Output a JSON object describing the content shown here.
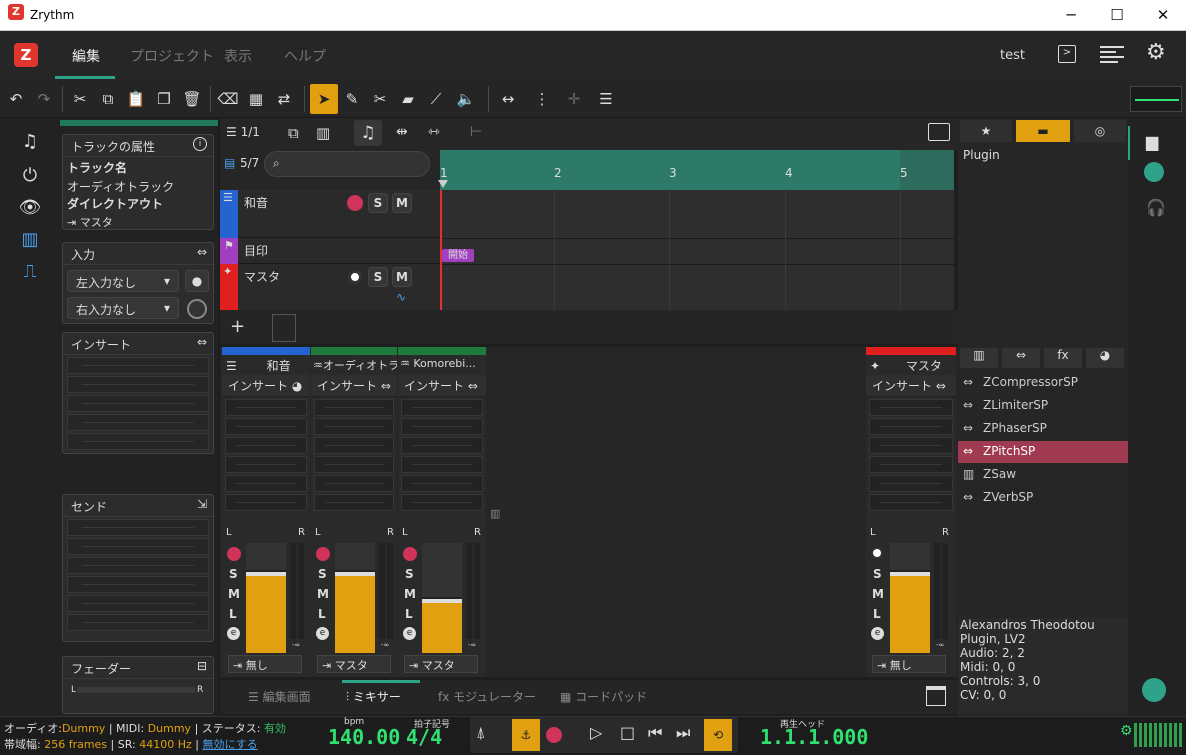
{
  "window": {
    "title": "Zrythm",
    "min": "─",
    "max": "☐",
    "close": "✕"
  },
  "menu": {
    "items": [
      "編集",
      "プロジェクト",
      "表示",
      "ヘルプ"
    ],
    "active": "編集",
    "user": "test"
  },
  "toolbar": {
    "icons": [
      "undo-icon",
      "redo-icon",
      "cut-icon",
      "copy-icon",
      "paste-icon",
      "duplicate-icon",
      "delete-icon",
      "clear-icon",
      "select-all-icon",
      "loop-icon",
      "select-tool-icon",
      "pencil-tool-icon",
      "cut-tool-icon",
      "eraser-tool-icon",
      "ramp-tool-icon",
      "audition-tool-icon"
    ]
  },
  "inspector": {
    "track_props": "トラックの属性",
    "track_name_label": "トラック名",
    "track_name_value": "オーディオトラック",
    "direct_out_label": "ダイレクトアウト",
    "direct_out_value": "マスタ",
    "input_title": "入力",
    "left_input": "左入力なし",
    "right_input": "右入力なし",
    "inserts_title": "インサート",
    "sends_title": "センド",
    "fader_title": "フェーダー",
    "fader_l": "L",
    "fader_r": "R"
  },
  "arranger": {
    "tracks_count": "1/1",
    "visible_tracks": "5/7",
    "ruler": [
      "1",
      "2",
      "3",
      "4",
      "5"
    ],
    "tracks": [
      {
        "name": "和音",
        "color": "#2563d0"
      },
      {
        "name": "目印",
        "color": "#a040c0"
      },
      {
        "name": "マスタ",
        "color": "#e02020"
      }
    ],
    "marker": "開始",
    "s_label": "S",
    "m_label": "M"
  },
  "mixer": {
    "channels": [
      {
        "name": "和音",
        "color": "#2563d0",
        "insert": "インサート",
        "out": "無し",
        "fader": 0.7
      },
      {
        "name": "オーディオトラ...",
        "color": "#1f7a3e",
        "insert": "インサート",
        "out": "マスタ",
        "fader": 0.7
      },
      {
        "name": "Komorebi...",
        "color": "#1f7a3e",
        "insert": "インサート",
        "out": "マスタ",
        "fader": 0.45
      }
    ],
    "master": {
      "name": "マスタ",
      "color": "#e02020",
      "insert": "インサート",
      "out": "無し",
      "fader": 0.7
    },
    "l": "L",
    "r": "R",
    "s": "S",
    "m": "M",
    "lbl": "L",
    "e": "e",
    "db": "-∞"
  },
  "bottom_tabs": [
    "編集画面",
    "ミキサー",
    "モジュレーター",
    "コードパッド"
  ],
  "bottom_active": "ミキサー",
  "browser": {
    "plugin_label": "Plugin",
    "plugins": [
      "ZCompressorSP",
      "ZLimiterSP",
      "ZPhaserSP",
      "ZPitchSP",
      "ZSaw",
      "ZVerbSP"
    ],
    "selected": "ZPitchSP",
    "info": [
      "Alexandros Theodotou",
      "Plugin, LV2",
      "Audio: 2, 2",
      "Midi: 0, 0",
      "Controls: 3, 0",
      "CV: 0, 0"
    ]
  },
  "status": {
    "audio_label": "オーディオ:",
    "audio_value": "Dummy",
    "midi_label": "MIDI:",
    "midi_value": "Dummy",
    "state_label": "ステータス:",
    "state_value": "有効",
    "bw_label": "帯域幅:",
    "bw_value": "256 frames",
    "sr_label": "SR:",
    "sr_value": "44100 Hz",
    "disable": "無効にする",
    "bpm_label": "bpm",
    "bpm_value": "140.00",
    "time_sig_label": "拍子記号",
    "time_sig_value": "4/4",
    "playhead_label": "再生ヘッド",
    "playhead_value": "1.1.1.000"
  }
}
